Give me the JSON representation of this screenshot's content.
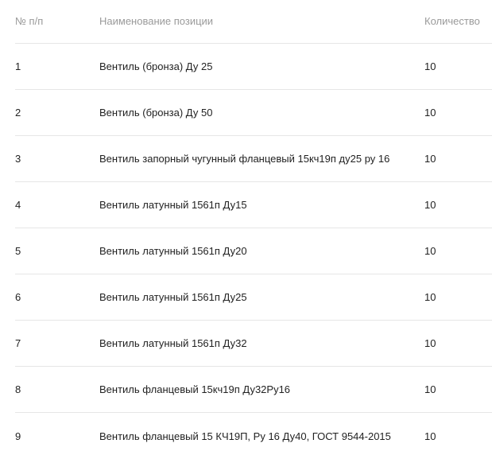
{
  "table": {
    "headers": {
      "num": "№ п/п",
      "name": "Наименование позиции",
      "qty": "Количество"
    },
    "rows": [
      {
        "num": "1",
        "name": "Вентиль (бронза) Ду 25",
        "qty": "10"
      },
      {
        "num": "2",
        "name": "Вентиль (бронза) Ду 50",
        "qty": "10"
      },
      {
        "num": "3",
        "name": "Вентиль запорный чугунный фланцевый 15кч19п ду25 ру 16",
        "qty": "10"
      },
      {
        "num": "4",
        "name": "Вентиль латунный 1561п Ду15",
        "qty": "10"
      },
      {
        "num": "5",
        "name": "Вентиль латунный 1561п Ду20",
        "qty": "10"
      },
      {
        "num": "6",
        "name": "Вентиль латунный 1561п Ду25",
        "qty": "10"
      },
      {
        "num": "7",
        "name": "Вентиль латунный 1561п Ду32",
        "qty": "10"
      },
      {
        "num": "8",
        "name": "Вентиль фланцевый 15кч19п Ду32Ру16",
        "qty": "10"
      },
      {
        "num": "9",
        "name": "Вентиль фланцевый 15 КЧ19П, Ру 16 Ду40, ГОСТ 9544-2015",
        "qty": "10"
      }
    ]
  }
}
